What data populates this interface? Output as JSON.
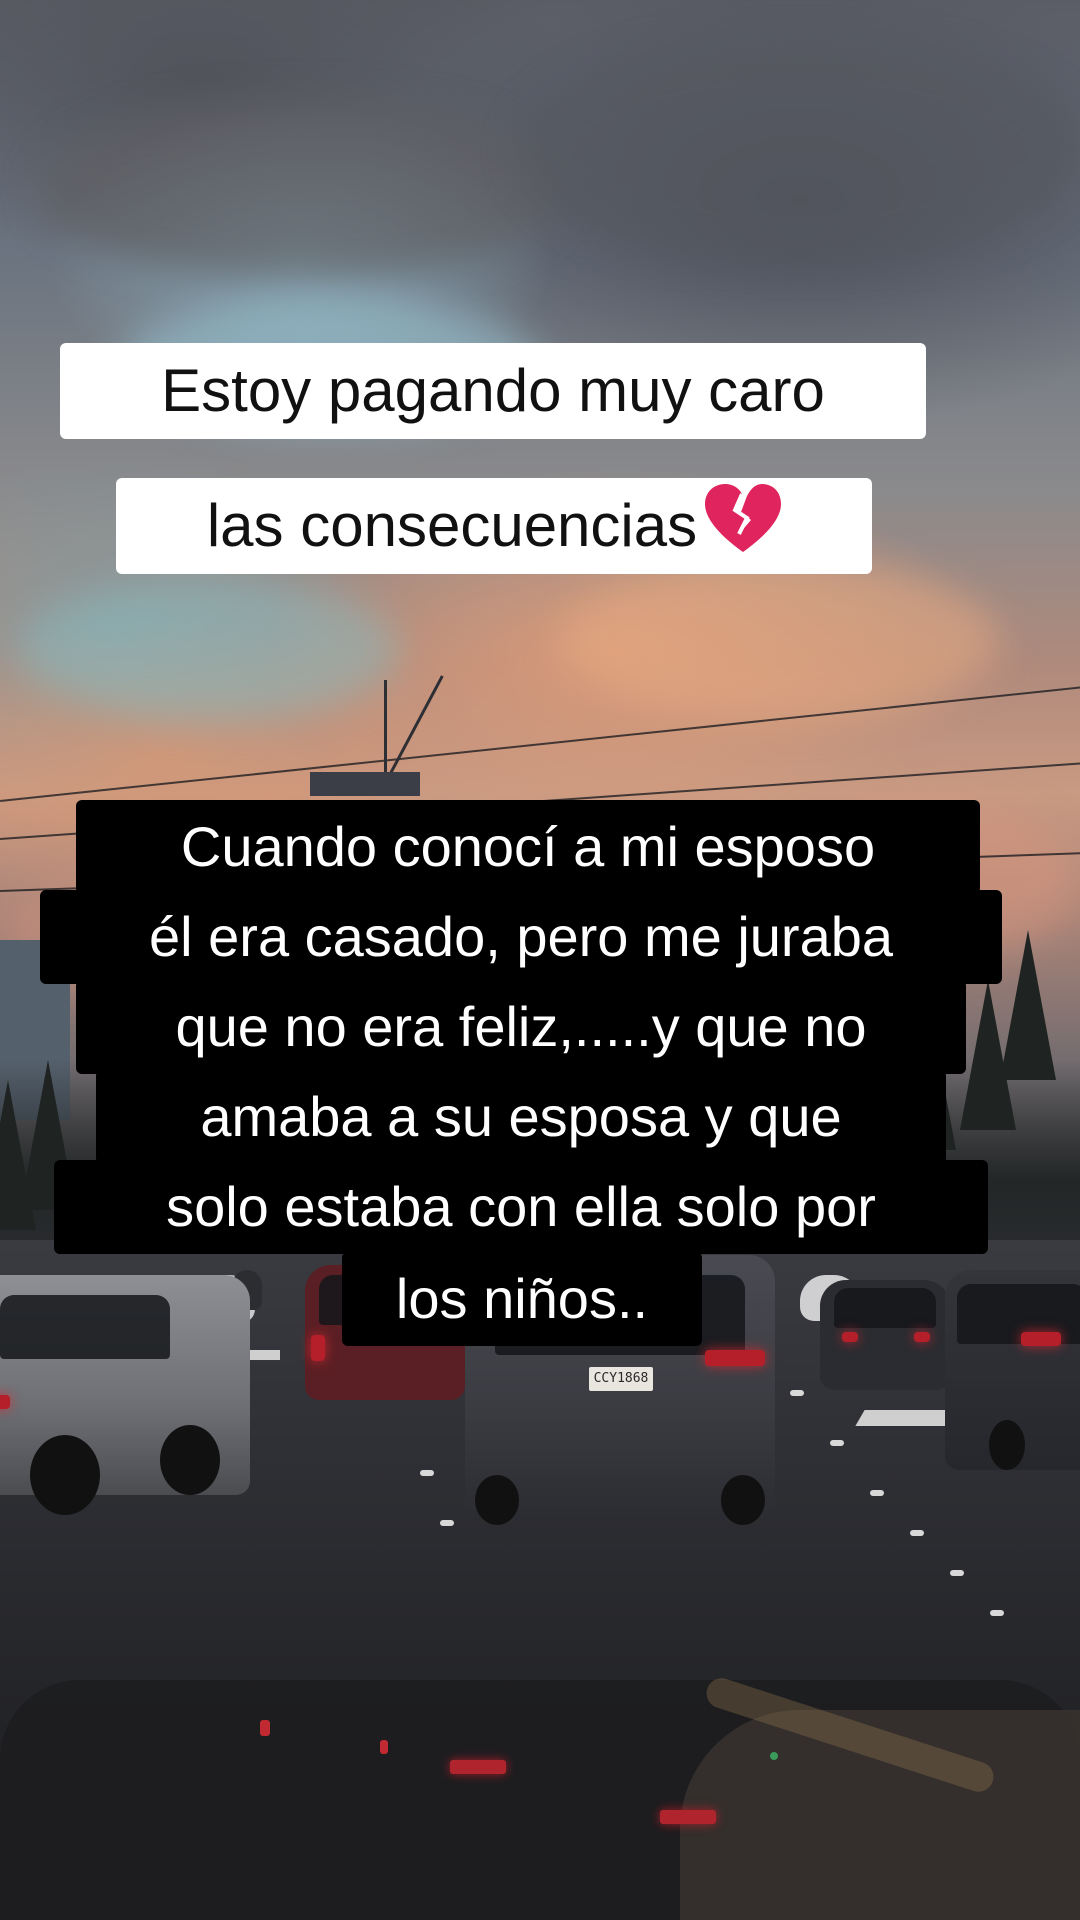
{
  "title_caption": {
    "lines": [
      "Estoy pagando muy caro",
      "las consecuencias"
    ],
    "emoji": "broken-heart"
  },
  "story_caption": {
    "lines": [
      "Cuando conocí a mi esposo",
      "él era casado, pero me juraba",
      "que no era feliz,.....y que no",
      "amaba a su  esposa y que",
      "solo estaba con ella solo por",
      "los niños.."
    ]
  },
  "scene": {
    "license_plate": "CCY1868",
    "colors": {
      "caption_white_bg": "#ffffff",
      "caption_black_bg": "#000000",
      "tail_light": "#b51f2a",
      "heart": "#e0245e"
    }
  }
}
